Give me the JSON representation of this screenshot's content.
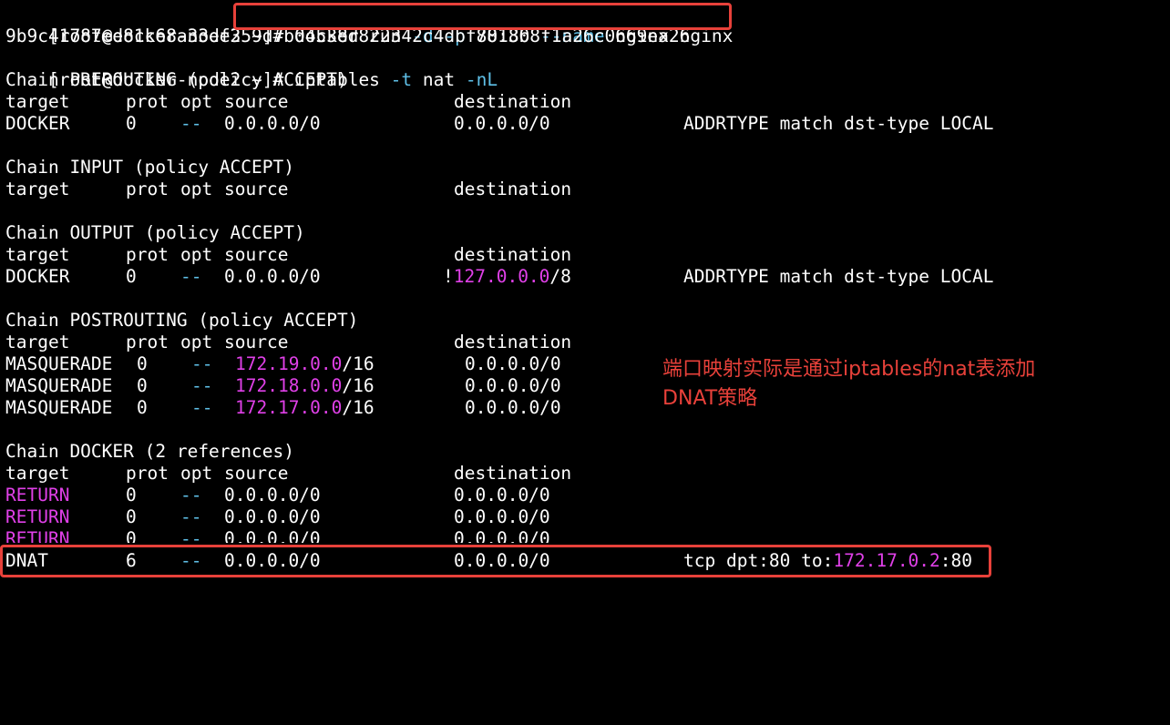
{
  "prompt": "[root@docker-node2 ~]",
  "commands": {
    "docker_run": {
      "hash": "# ",
      "cmd": "docker run ",
      "opt1": "-d",
      "opt2": "-p",
      "port": " 80:80 ",
      "opt3": "--name",
      "args": " nginx nginx"
    },
    "container_id": "9b9c41787ee81c68a33ef359d7b04538d822342c4dbf7813b8f1a26c0669ea26",
    "iptables": {
      "hash": "# ",
      "cmd": "iptables ",
      "opt1": "-t",
      "mid": " nat ",
      "opt2": "-nL"
    }
  },
  "headers": {
    "target": "target",
    "prot": "prot",
    "opt": "opt",
    "source": "source",
    "destination": "destination"
  },
  "chains": {
    "prerouting": {
      "title": "Chain PREROUTING (policy ACCEPT)",
      "rows": [
        {
          "target": "DOCKER",
          "prot": "0",
          "opt": "--",
          "source": "0.0.0.0/0",
          "destination": "0.0.0.0/0",
          "extra": "ADDRTYPE match dst-type LOCAL"
        }
      ]
    },
    "input": {
      "title": "Chain INPUT (policy ACCEPT)"
    },
    "output": {
      "title": "Chain OUTPUT (policy ACCEPT)",
      "rows": [
        {
          "target": "DOCKER",
          "prot": "0",
          "opt": "--",
          "source": "0.0.0.0/0",
          "dest_bang": "!",
          "dest_ip": "127.0.0.0",
          "dest_mask": "/8",
          "extra": "ADDRTYPE match dst-type LOCAL"
        }
      ]
    },
    "postrouting": {
      "title": "Chain POSTROUTING (policy ACCEPT)",
      "rows": [
        {
          "target": "MASQUERADE",
          "prot": "0",
          "opt": "--",
          "source_ip": "172.19.0.0",
          "source_mask": "/16",
          "destination": "0.0.0.0/0"
        },
        {
          "target": "MASQUERADE",
          "prot": "0",
          "opt": "--",
          "source_ip": "172.18.0.0",
          "source_mask": "/16",
          "destination": "0.0.0.0/0"
        },
        {
          "target": "MASQUERADE",
          "prot": "0",
          "opt": "--",
          "source_ip": "172.17.0.0",
          "source_mask": "/16",
          "destination": "0.0.0.0/0"
        }
      ]
    },
    "docker": {
      "title": "Chain DOCKER (2 references)",
      "rows": [
        {
          "target": "RETURN",
          "prot": "0",
          "opt": "--",
          "source": "0.0.0.0/0",
          "destination": "0.0.0.0/0"
        },
        {
          "target": "RETURN",
          "prot": "0",
          "opt": "--",
          "source": "0.0.0.0/0",
          "destination": "0.0.0.0/0"
        },
        {
          "target": "RETURN",
          "prot": "0",
          "opt": "--",
          "source": "0.0.0.0/0",
          "destination": "0.0.0.0/0"
        },
        {
          "target": "DNAT",
          "prot": "6",
          "opt": "--",
          "source": "0.0.0.0/0",
          "destination": "0.0.0.0/0",
          "extra_pre": "tcp dpt:80 to:",
          "extra_ip": "172.17.0.2",
          "extra_post": ":80"
        }
      ]
    }
  },
  "annotation": "端口映射实际是通过iptables的nat表添加DNAT策略",
  "colors": {
    "background": "#000000",
    "text": "#ffffff",
    "option": "#5fc0e8",
    "ip_highlight": "#e040e8",
    "box": "#e8413a",
    "annotation": "#e8413a"
  }
}
